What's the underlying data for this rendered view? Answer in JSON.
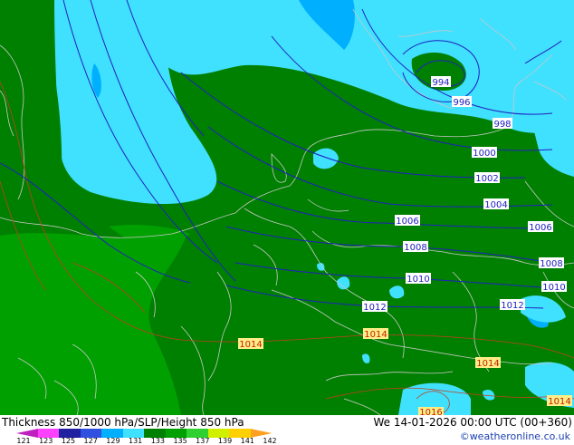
{
  "title": "Thickness 850/1000 hPa/SLP/Height 850 hPa",
  "valid_time": "We 14-01-2026 00:00 UTC (00+360)",
  "credit": "©weatheronline.co.uk",
  "colorbar": {
    "ticks": [
      "121",
      "123",
      "125",
      "127",
      "129",
      "131",
      "133",
      "135",
      "137",
      "139",
      "141",
      "142"
    ],
    "colors": [
      "#c020c0",
      "#ff40ff",
      "#2020a0",
      "#3050e0",
      "#00b0ff",
      "#40e0ff",
      "#008000",
      "#00a000",
      "#30d030",
      "#d0f000",
      "#ffd000",
      "#ffa020"
    ]
  },
  "isobars": [
    {
      "label": "994",
      "color": "#2020c0"
    },
    {
      "label": "996",
      "color": "#2020c0"
    },
    {
      "label": "998",
      "color": "#2020c0"
    },
    {
      "label": "1000",
      "color": "#2020c0"
    },
    {
      "label": "1002",
      "color": "#2020c0"
    },
    {
      "label": "1004",
      "color": "#2020c0"
    },
    {
      "label": "1006",
      "color": "#2020c0"
    },
    {
      "label": "1006",
      "color": "#2020c0"
    },
    {
      "label": "1008",
      "color": "#2020c0"
    },
    {
      "label": "1008",
      "color": "#2020c0"
    },
    {
      "label": "1010",
      "color": "#2020c0"
    },
    {
      "label": "1010",
      "color": "#2020c0"
    },
    {
      "label": "1012",
      "color": "#2020c0"
    },
    {
      "label": "1012",
      "color": "#2020c0"
    },
    {
      "label": "1014",
      "color": "#c02000"
    },
    {
      "label": "1014",
      "color": "#c02000"
    },
    {
      "label": "1014",
      "color": "#c02000"
    },
    {
      "label": "1014",
      "color": "#c02000"
    },
    {
      "label": "1016",
      "color": "#c02000"
    }
  ],
  "colors": {
    "dark_green": "#008000",
    "mid_green": "#00a000",
    "cyan": "#40e0ff",
    "light_blue": "#00b0ff",
    "border": "#c8c8c8",
    "isobar_low": "#2020c0",
    "isobar_high": "#c02000"
  }
}
